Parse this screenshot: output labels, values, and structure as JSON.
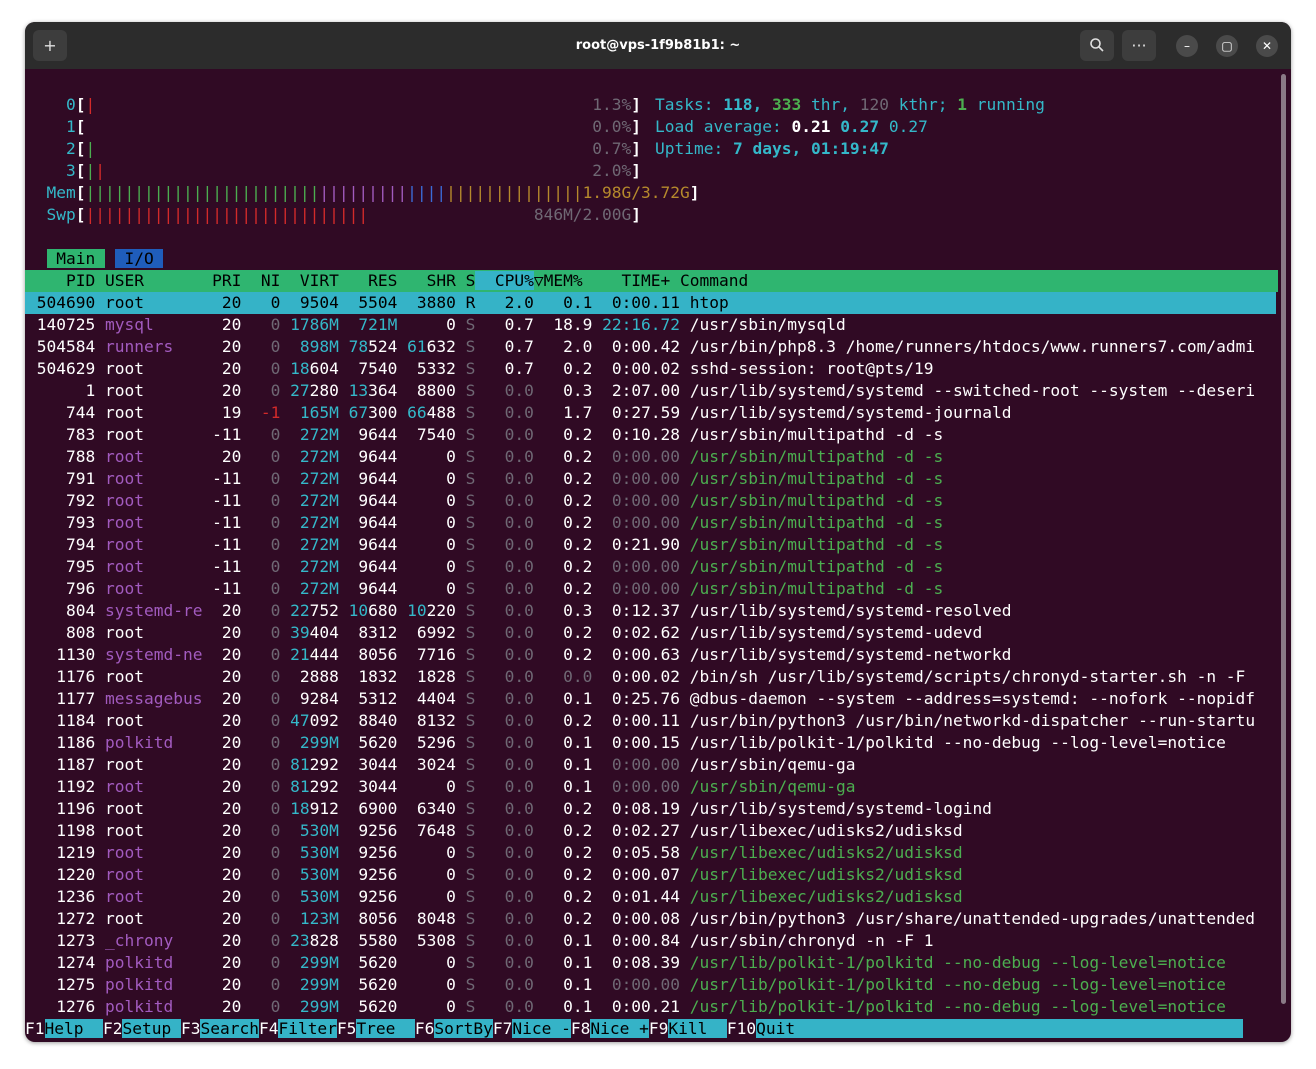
{
  "window": {
    "title": "root@vps-1f9b81b1: ~"
  },
  "cpus": [
    {
      "label": "0",
      "bars": "|",
      "bar_colors": [
        "red"
      ],
      "percent": "1.3%"
    },
    {
      "label": "1",
      "bars": "",
      "bar_colors": [],
      "percent": "0.0%"
    },
    {
      "label": "2",
      "bars": "|",
      "bar_colors": [
        "green"
      ],
      "percent": "0.7%"
    },
    {
      "label": "3",
      "bars": "||",
      "bar_colors": [
        "green",
        "red"
      ],
      "percent": "2.0%"
    }
  ],
  "mem": {
    "label": "Mem",
    "value": "1.98G/3.72G",
    "bar_segments": [
      {
        "color": "green",
        "count": 24
      },
      {
        "color": "purple",
        "count": 9
      },
      {
        "color": "blue",
        "count": 4
      },
      {
        "color": "yellow",
        "count": 14
      }
    ]
  },
  "swp": {
    "label": "Swp",
    "value": "846M/2.00G",
    "bar_segments": [
      {
        "color": "red",
        "count": 29
      }
    ]
  },
  "tasks": {
    "label": "Tasks:",
    "count": "118",
    "threads": "333",
    "thr_label": "thr,",
    "kthr": "120",
    "kthr_label": "kthr;",
    "running": "1",
    "running_label": "running"
  },
  "load": {
    "label": "Load average:",
    "one": "0.21",
    "five": "0.27",
    "fifteen": "0.27"
  },
  "uptime": {
    "label": "Uptime:",
    "value": "7 days, 01:19:47"
  },
  "tabs": [
    {
      "label": "Main",
      "active": true
    },
    {
      "label": "I/O",
      "active": false
    }
  ],
  "columns": [
    "PID",
    "USER",
    "PRI",
    "NI",
    "VIRT",
    "RES",
    "SHR",
    "S",
    "CPU%",
    "MEM%",
    "TIME+",
    "Command"
  ],
  "sort_indicator": "▽",
  "processes": [
    [
      "504690",
      "root",
      "20",
      "0",
      "9504",
      "5504",
      "3880",
      "R",
      "2.0",
      "0.1",
      "0:00.11",
      "htop"
    ],
    [
      "140725",
      "mysql",
      "20",
      "0",
      "1786M",
      "721M",
      "0",
      "S",
      "0.7",
      "18.9",
      "22:16.72",
      "/usr/sbin/mysqld"
    ],
    [
      "504584",
      "runners",
      "20",
      "0",
      "898M",
      "78524",
      "61632",
      "S",
      "0.7",
      "2.0",
      "0:00.42",
      "/usr/bin/php8.3 /home/runners/htdocs/www.runners7.com/admi"
    ],
    [
      "504629",
      "root",
      "20",
      "0",
      "18604",
      "7540",
      "5332",
      "S",
      "0.7",
      "0.2",
      "0:00.02",
      "sshd-session: root@pts/19"
    ],
    [
      "1",
      "root",
      "20",
      "0",
      "27280",
      "13364",
      "8800",
      "S",
      "0.0",
      "0.3",
      "2:07.00",
      "/usr/lib/systemd/systemd --switched-root --system --deseri"
    ],
    [
      "744",
      "root",
      "19",
      "-1",
      "165M",
      "67300",
      "66488",
      "S",
      "0.0",
      "1.7",
      "0:27.59",
      "/usr/lib/systemd/systemd-journald"
    ],
    [
      "783",
      "root",
      "-11",
      "0",
      "272M",
      "9644",
      "7540",
      "S",
      "0.0",
      "0.2",
      "0:10.28",
      "/usr/sbin/multipathd -d -s"
    ],
    [
      "788",
      "root",
      "20",
      "0",
      "272M",
      "9644",
      "0",
      "S",
      "0.0",
      "0.2",
      "0:00.00",
      "/usr/sbin/multipathd -d -s"
    ],
    [
      "791",
      "root",
      "-11",
      "0",
      "272M",
      "9644",
      "0",
      "S",
      "0.0",
      "0.2",
      "0:00.00",
      "/usr/sbin/multipathd -d -s"
    ],
    [
      "792",
      "root",
      "-11",
      "0",
      "272M",
      "9644",
      "0",
      "S",
      "0.0",
      "0.2",
      "0:00.00",
      "/usr/sbin/multipathd -d -s"
    ],
    [
      "793",
      "root",
      "-11",
      "0",
      "272M",
      "9644",
      "0",
      "S",
      "0.0",
      "0.2",
      "0:00.00",
      "/usr/sbin/multipathd -d -s"
    ],
    [
      "794",
      "root",
      "-11",
      "0",
      "272M",
      "9644",
      "0",
      "S",
      "0.0",
      "0.2",
      "0:21.90",
      "/usr/sbin/multipathd -d -s"
    ],
    [
      "795",
      "root",
      "-11",
      "0",
      "272M",
      "9644",
      "0",
      "S",
      "0.0",
      "0.2",
      "0:00.00",
      "/usr/sbin/multipathd -d -s"
    ],
    [
      "796",
      "root",
      "-11",
      "0",
      "272M",
      "9644",
      "0",
      "S",
      "0.0",
      "0.2",
      "0:00.00",
      "/usr/sbin/multipathd -d -s"
    ],
    [
      "804",
      "systemd-re",
      "20",
      "0",
      "22752",
      "10680",
      "10220",
      "S",
      "0.0",
      "0.3",
      "0:12.37",
      "/usr/lib/systemd/systemd-resolved"
    ],
    [
      "808",
      "root",
      "20",
      "0",
      "39404",
      "8312",
      "6992",
      "S",
      "0.0",
      "0.2",
      "0:02.62",
      "/usr/lib/systemd/systemd-udevd"
    ],
    [
      "1130",
      "systemd-ne",
      "20",
      "0",
      "21444",
      "8056",
      "7716",
      "S",
      "0.0",
      "0.2",
      "0:00.63",
      "/usr/lib/systemd/systemd-networkd"
    ],
    [
      "1176",
      "root",
      "20",
      "0",
      "2888",
      "1832",
      "1828",
      "S",
      "0.0",
      "0.0",
      "0:00.02",
      "/bin/sh /usr/lib/systemd/scripts/chronyd-starter.sh -n -F"
    ],
    [
      "1177",
      "messagebus",
      "20",
      "0",
      "9284",
      "5312",
      "4404",
      "S",
      "0.0",
      "0.1",
      "0:25.76",
      "@dbus-daemon --system --address=systemd: --nofork --nopidf"
    ],
    [
      "1184",
      "root",
      "20",
      "0",
      "47092",
      "8840",
      "8132",
      "S",
      "0.0",
      "0.2",
      "0:00.11",
      "/usr/bin/python3 /usr/bin/networkd-dispatcher --run-startu"
    ],
    [
      "1186",
      "polkitd",
      "20",
      "0",
      "299M",
      "5620",
      "5296",
      "S",
      "0.0",
      "0.1",
      "0:00.15",
      "/usr/lib/polkit-1/polkitd --no-debug --log-level=notice"
    ],
    [
      "1187",
      "root",
      "20",
      "0",
      "81292",
      "3044",
      "3024",
      "S",
      "0.0",
      "0.1",
      "0:00.00",
      "/usr/sbin/qemu-ga"
    ],
    [
      "1192",
      "root",
      "20",
      "0",
      "81292",
      "3044",
      "0",
      "S",
      "0.0",
      "0.1",
      "0:00.00",
      "/usr/sbin/qemu-ga"
    ],
    [
      "1196",
      "root",
      "20",
      "0",
      "18912",
      "6900",
      "6340",
      "S",
      "0.0",
      "0.2",
      "0:08.19",
      "/usr/lib/systemd/systemd-logind"
    ],
    [
      "1198",
      "root",
      "20",
      "0",
      "530M",
      "9256",
      "7648",
      "S",
      "0.0",
      "0.2",
      "0:02.27",
      "/usr/libexec/udisks2/udisksd"
    ],
    [
      "1219",
      "root",
      "20",
      "0",
      "530M",
      "9256",
      "0",
      "S",
      "0.0",
      "0.2",
      "0:05.58",
      "/usr/libexec/udisks2/udisksd"
    ],
    [
      "1220",
      "root",
      "20",
      "0",
      "530M",
      "9256",
      "0",
      "S",
      "0.0",
      "0.2",
      "0:00.07",
      "/usr/libexec/udisks2/udisksd"
    ],
    [
      "1236",
      "root",
      "20",
      "0",
      "530M",
      "9256",
      "0",
      "S",
      "0.0",
      "0.2",
      "0:01.44",
      "/usr/libexec/udisks2/udisksd"
    ],
    [
      "1272",
      "root",
      "20",
      "0",
      "123M",
      "8056",
      "8048",
      "S",
      "0.0",
      "0.2",
      "0:00.08",
      "/usr/bin/python3 /usr/share/unattended-upgrades/unattended"
    ],
    [
      "1273",
      "_chrony",
      "20",
      "0",
      "23828",
      "5580",
      "5308",
      "S",
      "0.0",
      "0.1",
      "0:00.84",
      "/usr/sbin/chronyd -n -F 1"
    ],
    [
      "1274",
      "polkitd",
      "20",
      "0",
      "299M",
      "5620",
      "0",
      "S",
      "0.0",
      "0.1",
      "0:08.39",
      "/usr/lib/polkit-1/polkitd --no-debug --log-level=notice"
    ],
    [
      "1275",
      "polkitd",
      "20",
      "0",
      "299M",
      "5620",
      "0",
      "S",
      "0.0",
      "0.1",
      "0:00.00",
      "/usr/lib/polkit-1/polkitd --no-debug --log-level=notice"
    ],
    [
      "1276",
      "polkitd",
      "20",
      "0",
      "299M",
      "5620",
      "0",
      "S",
      "0.0",
      "0.1",
      "0:00.21",
      "/usr/lib/polkit-1/polkitd --no-debug --log-level=notice"
    ]
  ],
  "thread_rows": [
    7,
    8,
    9,
    10,
    11,
    12,
    13,
    22,
    25,
    26,
    27,
    30,
    31,
    32
  ],
  "selected_row": 0,
  "function_keys": [
    {
      "key": "F1",
      "label": "Help  "
    },
    {
      "key": "F2",
      "label": "Setup "
    },
    {
      "key": "F3",
      "label": "Search"
    },
    {
      "key": "F4",
      "label": "Filter"
    },
    {
      "key": "F5",
      "label": "Tree  "
    },
    {
      "key": "F6",
      "label": "SortBy"
    },
    {
      "key": "F7",
      "label": "Nice -"
    },
    {
      "key": "F8",
      "label": "Nice +"
    },
    {
      "key": "F9",
      "label": "Kill  "
    },
    {
      "key": "F10",
      "label": "Quit"
    }
  ],
  "colors": {
    "background": "#300a24",
    "cyan": "#34b8c9",
    "green_header": "#2fb570",
    "selected": "#35b3c7"
  }
}
